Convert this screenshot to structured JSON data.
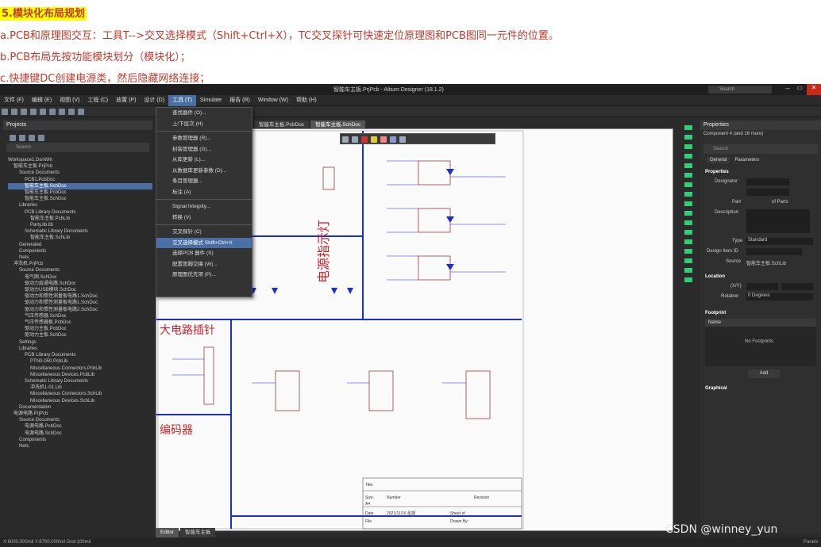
{
  "notes": {
    "heading": "5.模块化布局规划",
    "line_a": "a.PCB和原理图交互：工具T-->交叉选择模式（Shift+Ctrl+X），TC交叉探针可快速定位原理图和PCB图同一元件的位置。",
    "line_b": "b.PCB布局先按功能模块划分（模块化）；",
    "line_c": "c.快捷键DC创建电源类，然后隐藏网络连接；"
  },
  "window": {
    "title": "智能车主板.PrjPcb - Altium Designer (18.1.2)",
    "search_placeholder": "Search"
  },
  "menu": [
    "文件 (F)",
    "编辑 (E)",
    "视图 (V)",
    "工程 (C)",
    "放置 (P)",
    "设计 (D)",
    "工具 (T)",
    "Simulate",
    "报告 (R)",
    "Window (W)",
    "帮助 (H)"
  ],
  "tools_menu": [
    "查找器件 (O)...",
    "上/下层次 (H)",
    "参数管理器 (R)...",
    "封装管理器 (G)...",
    "从库更新 (L)...",
    "从数据库更新参数 (D)...",
    "条目管理器...",
    "标注 (A)",
    "Signal Integrity...",
    "转换 (V)",
    "交叉探针 (C)",
    "交叉选择模式  Shift+Ctrl+X",
    "选择PCB 器件 (S)",
    "配置管脚交换 (W)...",
    "原理图优先项 (P)..."
  ],
  "projects": {
    "header": "Projects",
    "search_placeholder": "Search",
    "tree": [
      "Workspace1.DsnWrk",
      "智能车主板.PrjPcb",
      "Source Documents",
      "PCB1.PcbDoc",
      "智能车主板.SchDoc",
      "智能车主板.PcbDoc",
      "智能车主板.SchDoc",
      "Libraries",
      "PCB Library Documents",
      "智能车主板.PcbLib",
      "Party.lib.lib",
      "Schematic Library Documents",
      "智能车主板.SchLib",
      "Generated",
      "Components",
      "Nets",
      "冲洗机.PrjPcb",
      "Source Documents",
      "电气图.SchDoc",
      "驱动力层通电路.SchDoc",
      "驱动力USB模块.SchDoc",
      "驱动力和惯性测量板电路1.SchDoc",
      "驱动力和惯性测量板电路1.SchDoc",
      "驱动力和惯性测量板电路2.SchDoc",
      "气压传感器.SchDoc",
      "气压传感器板.PcbDoc",
      "驱动力主板.PcbDoc",
      "驱动力主板.SchDoc",
      "Settings",
      "Libraries",
      "PCB Library Documents",
      "PTN0-050.PcbLib",
      "Miscellaneous Connectors.PcbLib",
      "Miscellaneous Devices.PcbLib",
      "Schematic Library Documents",
      "冲洗机1-01.Lib",
      "Miscellaneous Connectors.SchLib",
      "Miscellaneous Devices.SchLib",
      "Documentation",
      "电源电路.PrjPcb",
      "Source Documents",
      "电源电路.PcbDoc",
      "电源电路.SchDoc",
      "Components",
      "Nets"
    ]
  },
  "tabs": [
    "智能车主板.PcbDoc",
    "智能车主板.SchDoc"
  ],
  "schematic_labels": {
    "power_indicator": "电源指示灯",
    "big_circuit": "大电路插针",
    "encoder": "编码器",
    "title_block": [
      "Title",
      "Size",
      "Number",
      "Revision",
      "A4",
      "Date",
      "File",
      "2021/11/16 星期",
      "Sheet of",
      "Drawn By:"
    ]
  },
  "properties": {
    "header": "Properties",
    "component_label": "Component  4 (and 16 more)",
    "search": "Search",
    "tabs": [
      "General",
      "Parameters"
    ],
    "sections": [
      "Properties",
      "Location",
      "Footprint",
      "Graphical"
    ],
    "fields": {
      "designator": "Designator",
      "part": "Part",
      "of_parts": "of Parts",
      "description": "Description",
      "type": "Type",
      "type_value": "Standard",
      "design_item": "Design Item ID",
      "source": "Source",
      "source_value": "智能车主板.SchLib",
      "xy": "(X/Y)",
      "rotation": "Rotation",
      "rotation_value": "0 Degrees",
      "name": "Name",
      "no_footprints": "No Footprints",
      "add": "Add"
    }
  },
  "bottom_tabs": [
    "Editor",
    "智能车主板"
  ],
  "status": "X:6000.000mil Y:8700.000mil   Grid:100mil",
  "panels_btn": "Panels",
  "watermark": "CSDN @winney_yun"
}
